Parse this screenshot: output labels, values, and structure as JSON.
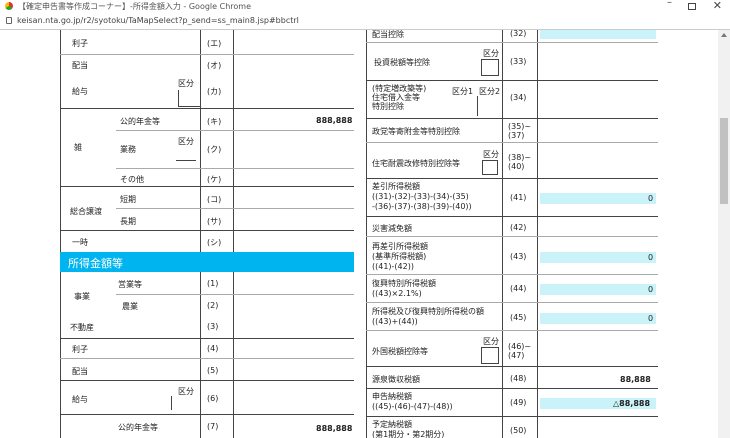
{
  "window": {
    "title": "【確定申告書等作成コーナー】-所得金額入力 - Google Chrome",
    "url": "keisan.nta.go.jp/r2/syotoku/TaMapSelect?p_send=ss_main8.jsp#bbctrl"
  },
  "left_table": {
    "rows_top": [
      {
        "label": "利子",
        "code": "(エ)"
      },
      {
        "label": "配当",
        "code": "(オ)"
      },
      {
        "label": "給与",
        "kubun": "区分",
        "code": "(カ)"
      },
      {
        "sub": "公的年金等",
        "code": "(キ)",
        "amount": "888,888"
      },
      {
        "group": "雑",
        "sub": "業務",
        "kubun": "区分",
        "code": "(ク)"
      },
      {
        "sub": "その他",
        "code": "(ケ)"
      },
      {
        "group": "総合譲渡",
        "sub": "短期",
        "code": "(コ)"
      },
      {
        "sub": "長期",
        "code": "(サ)"
      },
      {
        "label": "一時",
        "code": "(シ)"
      }
    ],
    "section_title": "所得金額等",
    "rows_bottom": [
      {
        "group": "事業",
        "sub": "営業等",
        "code": "(1)"
      },
      {
        "sub": "農業",
        "code": "(2)"
      },
      {
        "label": "不動産",
        "code": "(3)"
      },
      {
        "label": "利子",
        "code": "(4)"
      },
      {
        "label": "配当",
        "code": "(5)"
      },
      {
        "label": "給与",
        "kubun": "区分",
        "code": "(6)"
      },
      {
        "sub": "公的年金等",
        "code": "(7)",
        "amount": "888,888"
      }
    ]
  },
  "right_table": {
    "rows": [
      {
        "label": "配当控除",
        "code": "(32)"
      },
      {
        "label": "投資税額等控除",
        "kubun": "区分",
        "code": "(33)"
      },
      {
        "label": "(特定増改築等)\n住宅借入金等\n特別控除",
        "kubun1": "区分1",
        "kubun2": "区分2",
        "code": "(34)"
      },
      {
        "label": "政党等寄附金等特別控除",
        "code": "(35)~\n(37)"
      },
      {
        "label": "住宅耐震改修特別控除等",
        "kubun": "区分",
        "code": "(38)~\n(40)"
      },
      {
        "label": "差引所得税額\n((31)-(32)-(33)-(34)-(35)\n-(36)-(37)-(38)-(39)-(40))",
        "code": "(41)",
        "value": "0"
      },
      {
        "label": "災害減免額",
        "code": "(42)"
      },
      {
        "label": "再差引所得税額\n(基準所得税額)\n((41)-(42))",
        "code": "(43)",
        "value": "0"
      },
      {
        "label": "復興特別所得税額\n((43)×2.1%)",
        "code": "(44)",
        "value": "0"
      },
      {
        "label": "所得税及び復興特別所得税の額\n((43)+(44))",
        "code": "(45)",
        "value": "0"
      },
      {
        "label": "外国税額控除等",
        "kubun": "区分",
        "code": "(46)~\n(47)"
      },
      {
        "label": "源泉徴収税額",
        "code": "(48)",
        "value": "88,888"
      },
      {
        "label": "申告納税額\n((45)-(46)-(47)-(48))",
        "code": "(49)",
        "value": "△88,888"
      },
      {
        "label": "予定納税額\n(第1期分・第2期分)",
        "code": "(50)"
      }
    ]
  },
  "colors": {
    "section_bg": "#00b4ef",
    "cyan_field": "#c9f3f8"
  }
}
